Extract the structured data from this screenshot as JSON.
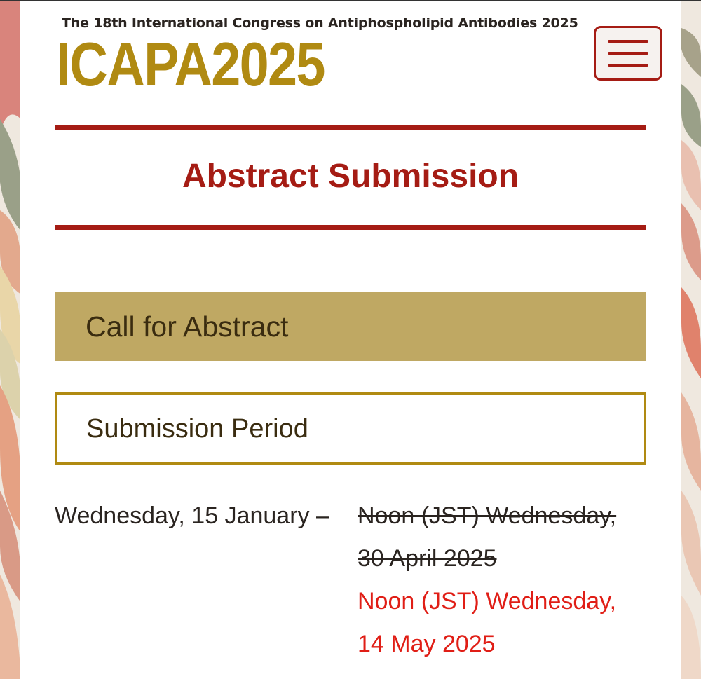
{
  "header": {
    "tagline": "The 18th International Congress on Antiphospholipid Antibodies 2025",
    "logo": "ICAPA2025",
    "menu_icon": "hamburger-menu-icon"
  },
  "main": {
    "page_title": "Abstract Submission",
    "section_heading": "Call for Abstract",
    "subsection_heading": "Submission Period",
    "period_start": "Wednesday, 15 January –",
    "old_deadline_line1": "Noon (JST) Wednesday,",
    "old_deadline_line2": "30 April 2025",
    "new_deadline_line1": "Noon (JST) Wednesday,",
    "new_deadline_line2": "14 May 2025"
  },
  "colors": {
    "brand_red": "#a51c14",
    "brand_gold": "#b08a12",
    "heading_box": "#bfa863",
    "deadline_red": "#e01e16"
  }
}
